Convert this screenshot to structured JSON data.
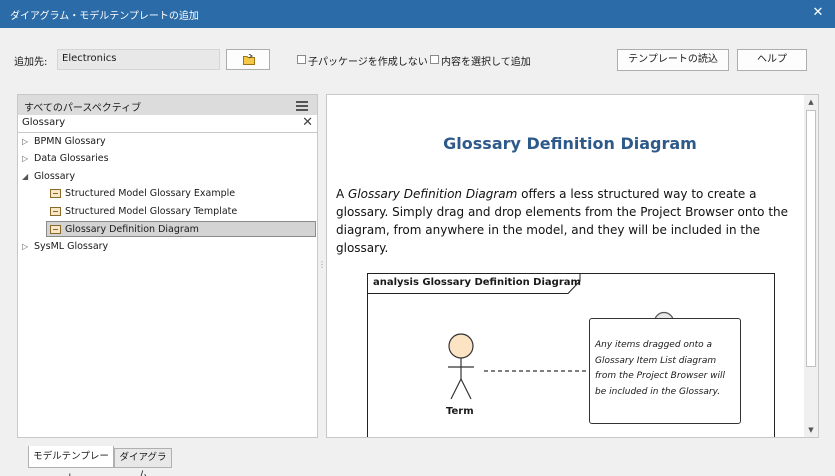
{
  "window": {
    "title": "ダイアグラム・モデルテンプレートの追加"
  },
  "toolbar": {
    "dest_label": "追加先:",
    "dest_value": "Electronics",
    "no_subpackage_label": "子パッケージを作成しない",
    "select_content_label": "内容を選択して追加",
    "load_template_label": "テンプレートの読込",
    "help_label": "ヘルプ"
  },
  "left_panel": {
    "header": "すべてのパースペクティブ",
    "search_value": "Glossary",
    "tree": [
      {
        "label": "BPMN Glossary",
        "expanded": false
      },
      {
        "label": "Data Glossaries",
        "expanded": false
      },
      {
        "label": "Glossary",
        "expanded": true
      },
      {
        "label": "Structured Model Glossary Example"
      },
      {
        "label": "Structured Model Glossary Template"
      },
      {
        "label": "Glossary Definition Diagram",
        "selected": true
      },
      {
        "label": "SysML Glossary",
        "expanded": false
      }
    ]
  },
  "preview": {
    "title": "Glossary Definition Diagram",
    "body_prefix": "A ",
    "body_em": "Glossary Definition Diagram",
    "body_rest": " offers a less structured way to create a glossary. Simply drag and drop elements from the Project Browser onto the diagram, from anywhere in the model, and they will be included in the glossary.",
    "diagram_label": "analysis Glossary Definition Diagram",
    "actor_label": "Term",
    "note_text": "Any items dragged onto a Glossary Item List diagram from the Project Browser will be included in the Glossary."
  },
  "tabs": [
    {
      "label": "モデルテンプレート",
      "active": true
    },
    {
      "label": "ダイアグラム",
      "active": false
    }
  ],
  "colors": {
    "titlebar": "#2b6ba8",
    "heading": "#2e5a8a",
    "actor_fill": "#fbe3c3"
  }
}
